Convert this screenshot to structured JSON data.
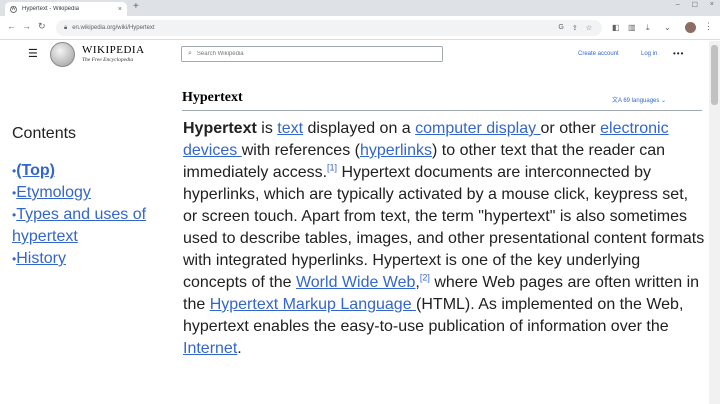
{
  "browser": {
    "tab_title": "Hypertext - Wikipedia",
    "favicon_letter": "W",
    "tab_close": "×",
    "new_tab": "+",
    "url": "en.wikipedia.org/wiki/Hypertext",
    "back": "←",
    "forward": "→",
    "reload": "↻",
    "window_min": "–",
    "window_max": "☐",
    "window_close": "×"
  },
  "wiki": {
    "wordmark": "WIKIPEDIA",
    "tagline": "The Free Encyclopedia",
    "search_placeholder": "Search Wikipedia",
    "create_account": "Create account",
    "log_in": "Log in",
    "more": "•••",
    "languages": "69 languages"
  },
  "article": {
    "title": "Hypertext",
    "p": {
      "t1": "Hypertext",
      "t2": " is ",
      "l_text": "text",
      "t3": " displayed on a ",
      "l_display": "computer display ",
      "t4": "or other ",
      "l_devices": "electronic devices ",
      "t5": "with references (",
      "l_hyperlinks": "hyperlinks",
      "t6": ") to other text that the reader can immediately access.",
      "ref1": "[1]",
      "t7": " Hypertext documents are interconnected by hyperlinks, which are typically activated by a mouse click, keypress set, or screen touch. Apart from text, the term \"hypertext\" is also sometimes used to describe tables, images, and other presentational content formats with integrated hyperlinks. Hypertext is one of the key underlying concepts of the ",
      "l_www": "World Wide Web",
      "t8": ",",
      "ref2": "[2]",
      "t9": " where Web pages are often written in the ",
      "l_html": "Hypertext Markup Language ",
      "t10": "(HTML). As implemented on the Web, hypertext enables the easy-to-use publication of information over the ",
      "l_internet": "Internet",
      "t11": "."
    }
  },
  "toc": {
    "heading": "Contents",
    "items": [
      {
        "label": "(Top)"
      },
      {
        "label": "Etymology"
      },
      {
        "label": "Types and uses of hypertext"
      },
      {
        "label": "History"
      }
    ]
  }
}
